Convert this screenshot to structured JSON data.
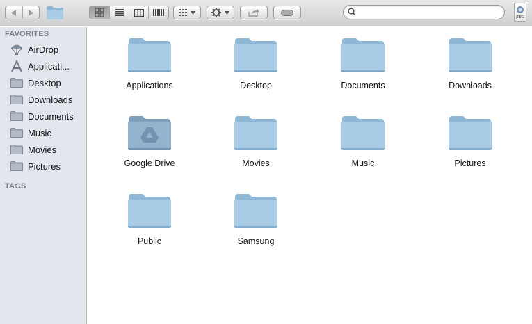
{
  "toolbar": {
    "search": {
      "placeholder": "",
      "value": ""
    },
    "preview_badge": "JPEG"
  },
  "sidebar": {
    "favorites_header": "FAVORITES",
    "favorites": [
      {
        "label": "AirDrop",
        "icon": "airdrop-icon"
      },
      {
        "label": "Applicati...",
        "icon": "applications-icon"
      },
      {
        "label": "Desktop",
        "icon": "folder-icon"
      },
      {
        "label": "Downloads",
        "icon": "folder-icon"
      },
      {
        "label": "Documents",
        "icon": "folder-icon"
      },
      {
        "label": "Music",
        "icon": "folder-icon"
      },
      {
        "label": "Movies",
        "icon": "folder-icon"
      },
      {
        "label": "Pictures",
        "icon": "folder-icon"
      }
    ],
    "tags_header": "TAGS"
  },
  "main": {
    "items": [
      {
        "label": "Applications",
        "icon": "folder-icon"
      },
      {
        "label": "Desktop",
        "icon": "folder-icon"
      },
      {
        "label": "Documents",
        "icon": "folder-icon"
      },
      {
        "label": "Downloads",
        "icon": "folder-icon"
      },
      {
        "label": "Google Drive",
        "icon": "google-drive-folder-icon"
      },
      {
        "label": "Movies",
        "icon": "folder-icon"
      },
      {
        "label": "Music",
        "icon": "folder-icon"
      },
      {
        "label": "Pictures",
        "icon": "folder-icon"
      },
      {
        "label": "Public",
        "icon": "folder-icon"
      },
      {
        "label": "Samsung",
        "icon": "folder-icon"
      }
    ]
  },
  "colors": {
    "folder_light": "#a9cde6",
    "folder_dark": "#7fa9c9",
    "sidebar_bg": "#e3e7ed"
  }
}
